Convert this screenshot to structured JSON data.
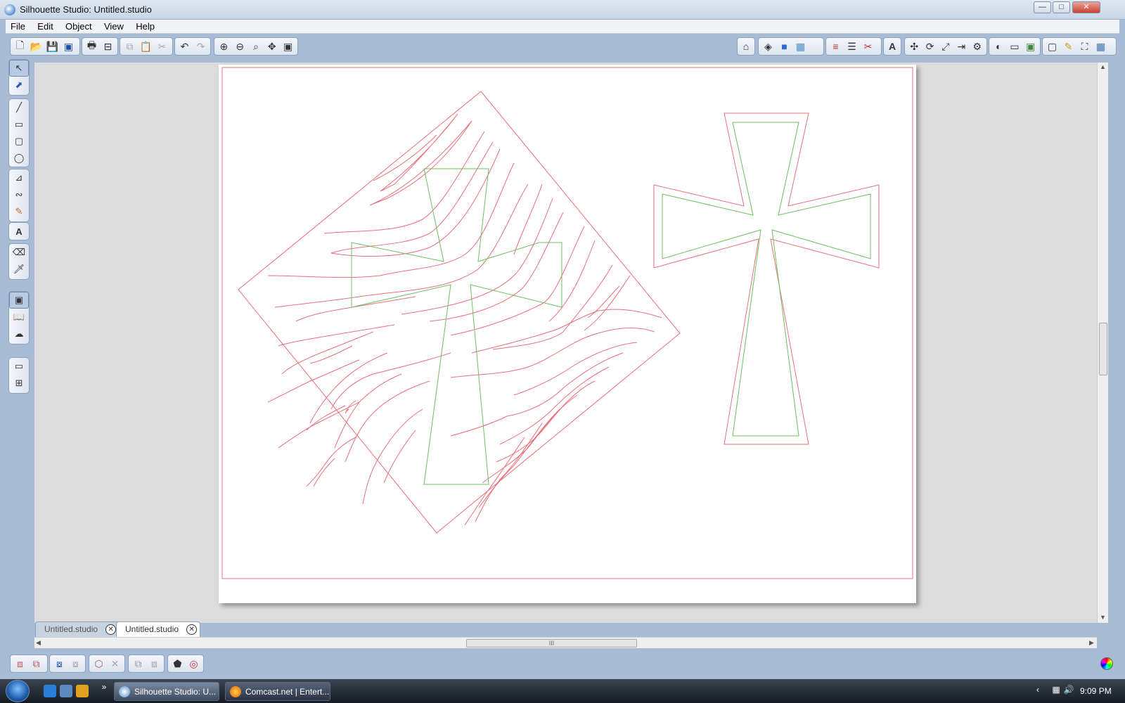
{
  "window": {
    "title": "Silhouette Studio: Untitled.studio",
    "minimize_glyph": "—",
    "maximize_glyph": "□",
    "close_glyph": "✕"
  },
  "menu": {
    "items": [
      "File",
      "Edit",
      "Object",
      "View",
      "Help"
    ]
  },
  "tabs": [
    {
      "label": "Untitled.studio",
      "active": false
    },
    {
      "label": "Untitled.studio",
      "active": true
    }
  ],
  "tab_close_glyph": "✕",
  "scroll": {
    "h_thumb_glyph": "III",
    "left": "◀",
    "right": "▶",
    "up": "▲",
    "down": "▼"
  },
  "taskbar": {
    "buttons": [
      {
        "label": "Silhouette Studio: U...",
        "active": true
      },
      {
        "label": "Comcast.net | Entert...",
        "active": false
      }
    ],
    "chevron": "»",
    "tray_arrow": "‹",
    "clock": "9:09 PM"
  },
  "colors": {
    "cut_line": "#e8707a",
    "registration_line": "#6cc060",
    "canvas_bg": "#dcdcdc",
    "chrome": "#a9bcd6"
  }
}
